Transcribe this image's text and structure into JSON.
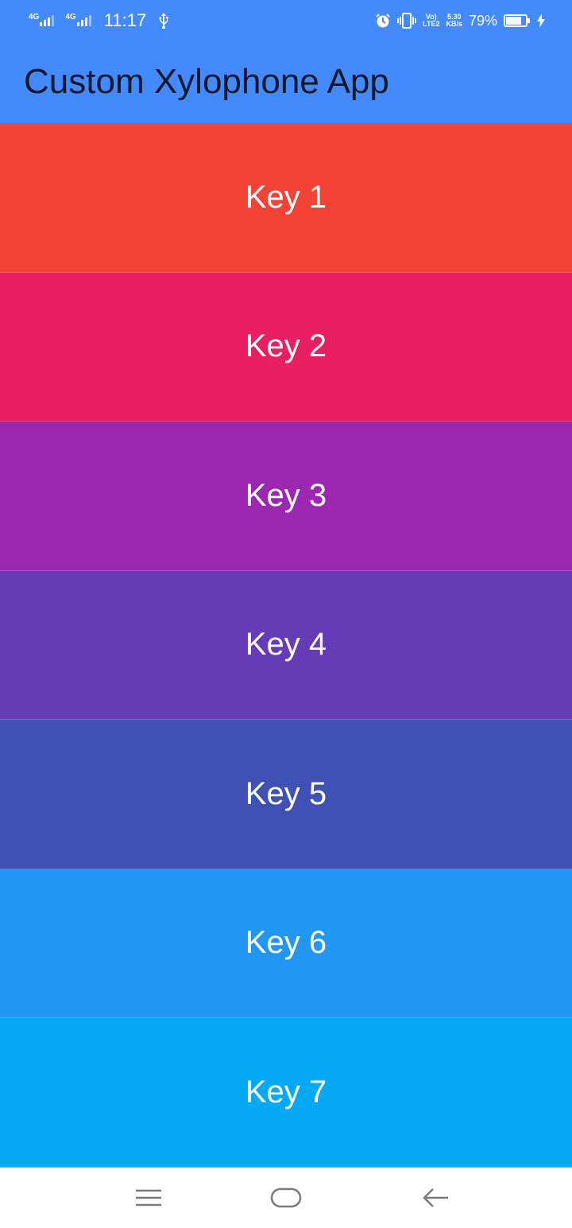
{
  "status_bar": {
    "network_1": "4G",
    "network_2": "4G",
    "time": "11:17",
    "volte_top": "Vo)",
    "volte_bottom": "LTE2",
    "speed_top": "5.30",
    "speed_bottom": "KB/s",
    "battery_percent": "79%",
    "battery_level": 0.79,
    "icons": [
      "usb-icon",
      "alarm-icon",
      "vibrate-icon",
      "battery-icon",
      "charging-icon"
    ]
  },
  "app_bar": {
    "title": "Custom Xylophone App",
    "color": "#448aff"
  },
  "keys": [
    {
      "label": "Key 1",
      "color": "#f44336"
    },
    {
      "label": "Key 2",
      "color": "#e91e63"
    },
    {
      "label": "Key 3",
      "color": "#9c27b0"
    },
    {
      "label": "Key 4",
      "color": "#673ab7"
    },
    {
      "label": "Key 5",
      "color": "#3f51b5"
    },
    {
      "label": "Key 6",
      "color": "#2196f3"
    },
    {
      "label": "Key 7",
      "color": "#03a9f4"
    }
  ],
  "nav_bar": {
    "icons": [
      "menu-icon",
      "home-icon",
      "back-icon"
    ]
  }
}
